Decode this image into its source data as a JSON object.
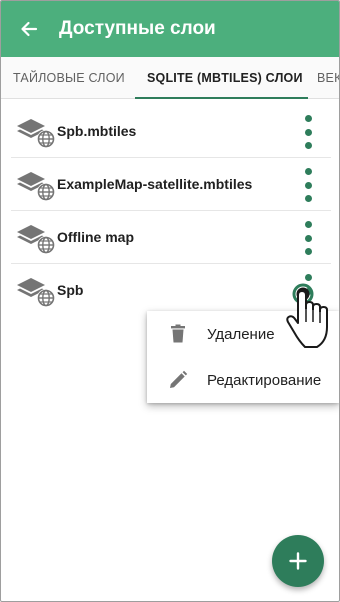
{
  "appbar": {
    "title": "Доступные слои",
    "back_icon": "arrow-left-icon"
  },
  "tabs": [
    {
      "label": "ТАЙЛОВЫЕ СЛОИ",
      "active": false
    },
    {
      "label": "SQLITE (MBTILES) СЛОИ",
      "active": true
    },
    {
      "label": "ВЕК",
      "active": false
    }
  ],
  "layers": [
    {
      "name": "Spb.mbtiles",
      "icon": "layers-globe-icon",
      "menu_icon": "more-vert-icon"
    },
    {
      "name": "ExampleMap-satellite.mbtiles",
      "icon": "layers-globe-icon",
      "menu_icon": "more-vert-icon"
    },
    {
      "name": "Offline map",
      "icon": "layers-globe-icon",
      "menu_icon": "more-vert-icon"
    },
    {
      "name": "Spb",
      "icon": "layers-globe-icon",
      "menu_icon": "more-vert-icon"
    }
  ],
  "context_menu": {
    "items": [
      {
        "label": "Удаление",
        "icon": "trash-icon"
      },
      {
        "label": "Редактирование",
        "icon": "pencil-icon"
      }
    ]
  },
  "fab": {
    "icon": "plus-icon"
  },
  "colors": {
    "appbar": "#4caf7d",
    "accent": "#2e7d5b",
    "icon_gray": "#757575"
  }
}
